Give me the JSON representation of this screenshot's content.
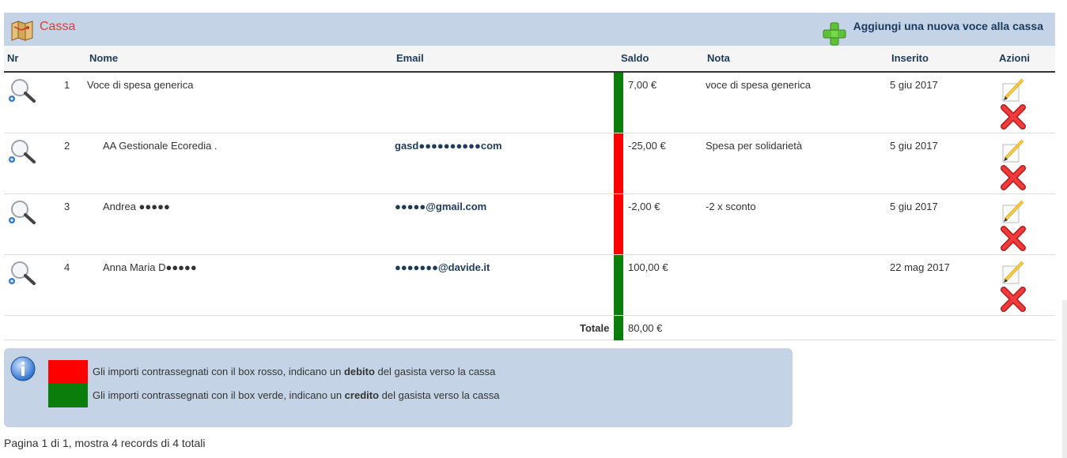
{
  "header": {
    "title": "Cassa",
    "icon": "map-icon",
    "add_label": "Aggiungi una nuova voce alla cassa"
  },
  "columns": {
    "nr": "Nr",
    "nome": "Nome",
    "email": "Email",
    "saldo": "Saldo",
    "nota": "Nota",
    "inserito": "Inserito",
    "azioni": "Azioni"
  },
  "rows": [
    {
      "nr": "1",
      "nome": "Voce di spesa generica",
      "email": "",
      "saldo": "7,00 €",
      "saldo_color": "#0a7d0a",
      "nota": "voce di spesa generica",
      "inserito": "5 giu 2017"
    },
    {
      "nr": "2",
      "nome": "AA Gestionale Ecoredia .",
      "email": "gasd●●●●●●●●●●com",
      "saldo": "-25,00 €",
      "saldo_color": "#ff0000",
      "nota": "Spesa per solidarietà",
      "inserito": "5 giu 2017"
    },
    {
      "nr": "3",
      "nome": "Andrea ●●●●●",
      "email": "●●●●●@gmail.com",
      "saldo": "-2,00 €",
      "saldo_color": "#ff0000",
      "nota": "-2 x sconto",
      "inserito": "5 giu 2017"
    },
    {
      "nr": "4",
      "nome": "Anna Maria D●●●●●",
      "email": "●●●●●●●@davide.it",
      "saldo": "100,00 €",
      "saldo_color": "#0a7d0a",
      "nota": "",
      "inserito": "22 mag 2017"
    }
  ],
  "totals": {
    "label": "Totale",
    "value": "80,00 €"
  },
  "legend": {
    "red_pre": "Gli importi contrassegnati con il box rosso, indicano un ",
    "red_bold": "debito",
    "red_post": " del gasista verso la cassa",
    "green_pre": "Gli importi contrassegnati con il box verde, indicano un ",
    "green_bold": "credito",
    "green_post": " del gasista verso la cassa"
  },
  "pagination": "Pagina 1 di 1, mostra 4 records di 4 totali",
  "colors": {
    "header_bg": "#c4d4e6",
    "title_red": "#e8392a",
    "debit": "#ff0000",
    "credit": "#0a7d0a"
  }
}
